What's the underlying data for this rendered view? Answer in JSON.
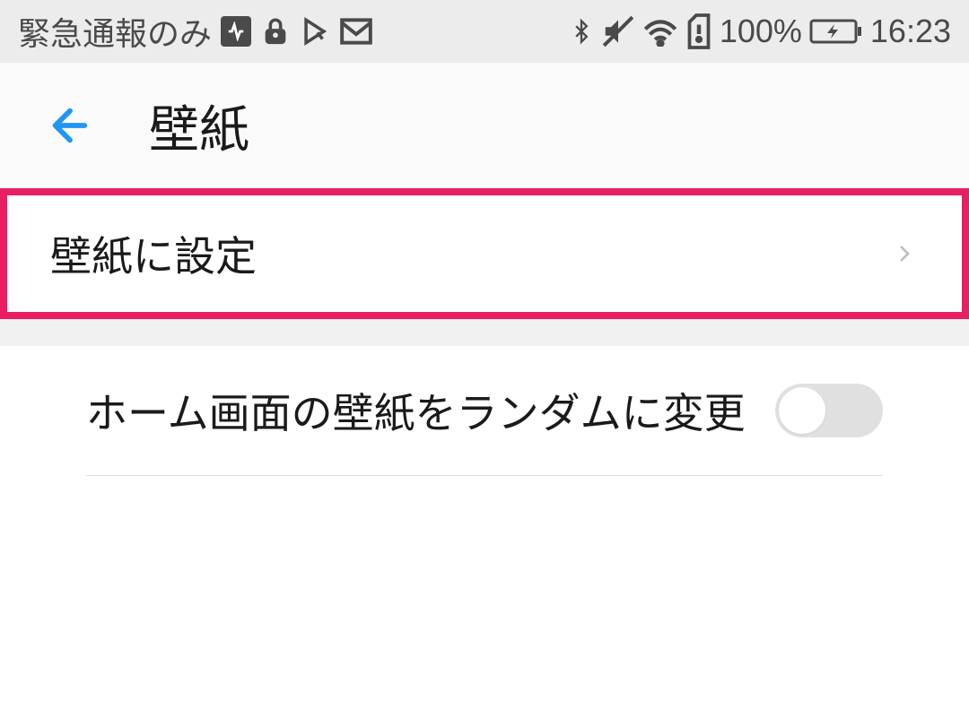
{
  "statusBar": {
    "networkText": "緊急通報のみ",
    "batteryPercent": "100%",
    "time": "16:23"
  },
  "header": {
    "title": "壁紙"
  },
  "rows": {
    "setWallpaper": {
      "label": "壁紙に設定"
    },
    "randomChange": {
      "label": "ホーム画面の壁紙をランダムに変更",
      "toggled": false
    }
  }
}
